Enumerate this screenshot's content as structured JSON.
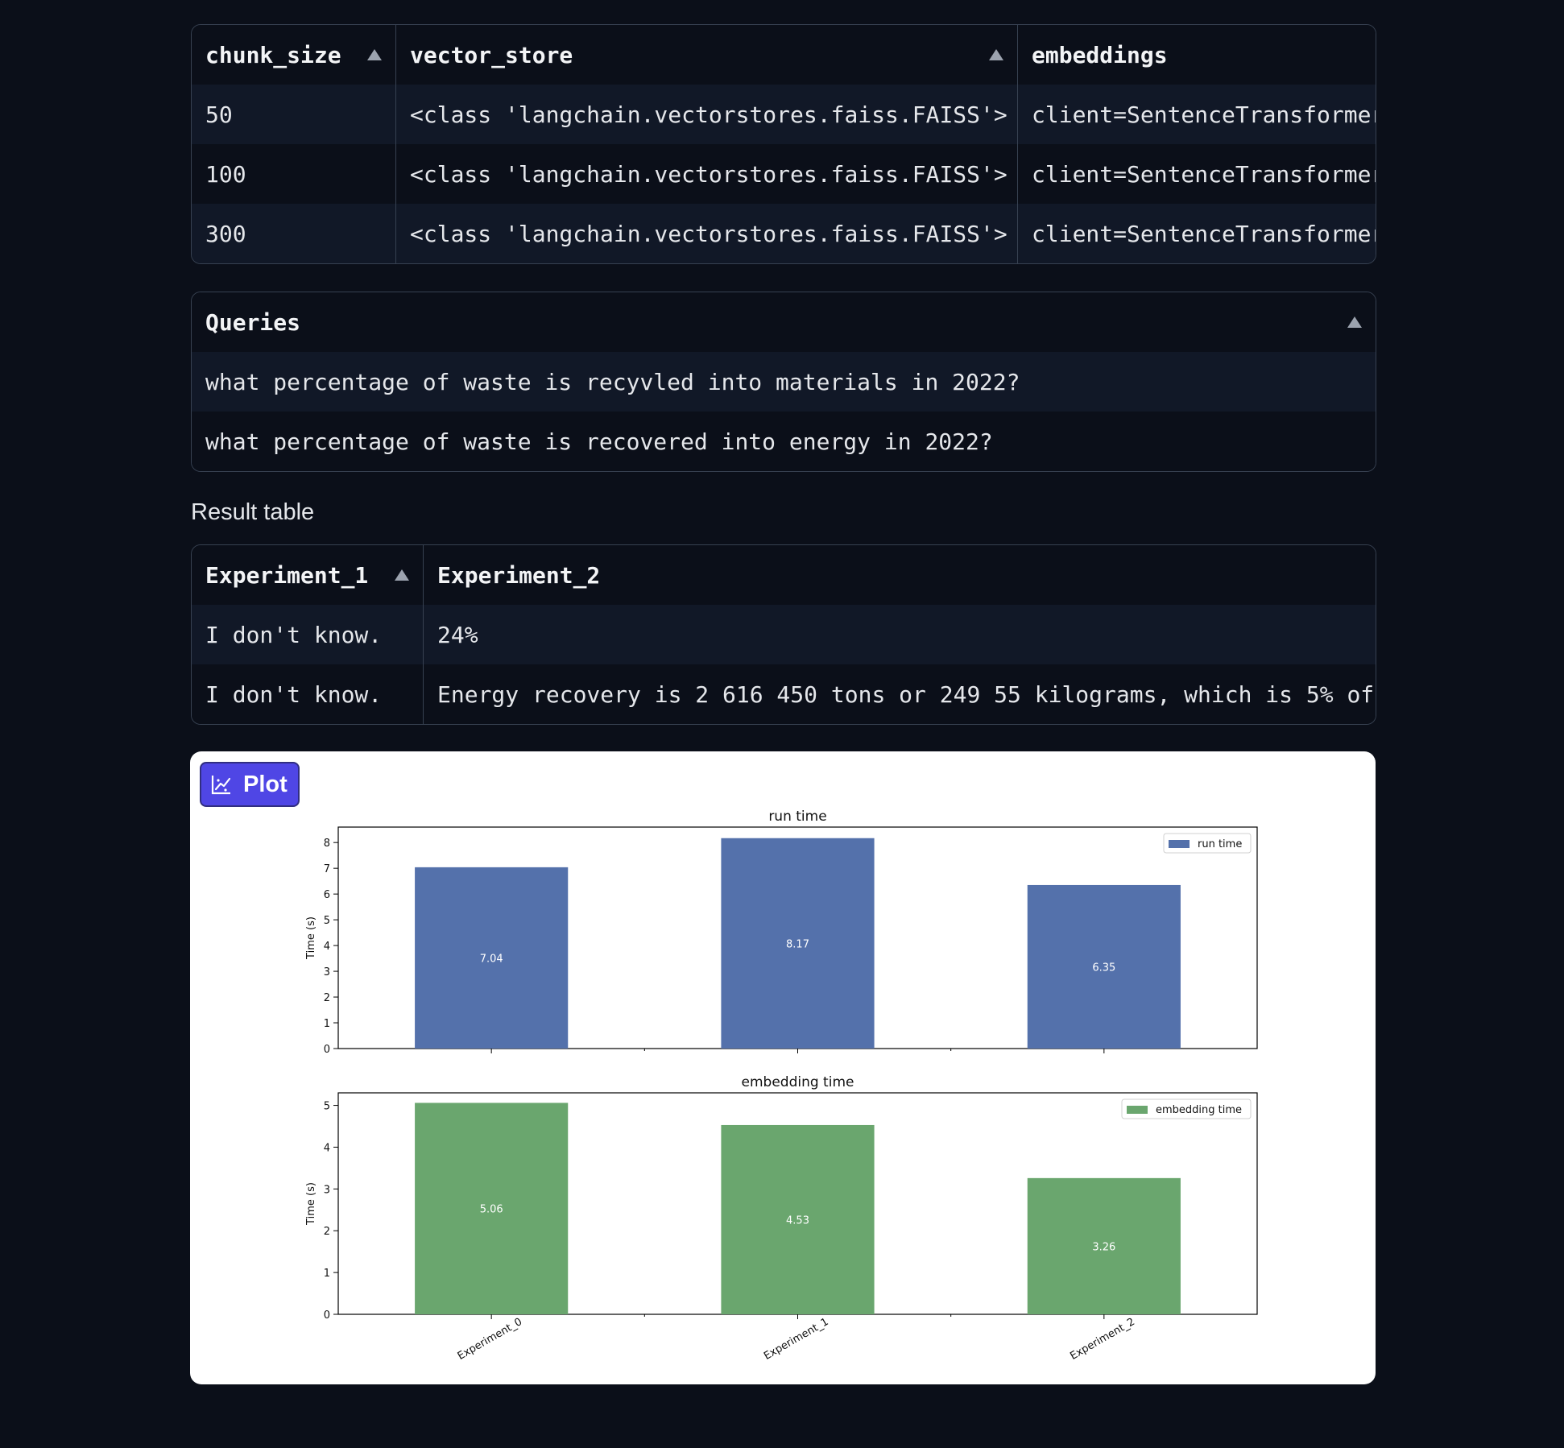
{
  "config_table": {
    "columns": [
      {
        "label": "chunk_size",
        "sortable": true
      },
      {
        "label": "vector_store",
        "sortable": true
      },
      {
        "label": "embeddings",
        "sortable": false
      }
    ],
    "rows": [
      [
        "50",
        "<class 'langchain.vectorstores.faiss.FAISS'>",
        "client=SentenceTransformer"
      ],
      [
        "100",
        "<class 'langchain.vectorstores.faiss.FAISS'>",
        "client=SentenceTransformer"
      ],
      [
        "300",
        "<class 'langchain.vectorstores.faiss.FAISS'>",
        "client=SentenceTransformer"
      ]
    ]
  },
  "queries_table": {
    "header": "Queries",
    "rows": [
      "what percentage of waste is recyvled into materials in 2022?",
      "what percentage of waste is recovered into energy in 2022?"
    ]
  },
  "result_label": "Result table",
  "result_table": {
    "columns": [
      {
        "label": "Experiment_1",
        "sortable": true
      },
      {
        "label": "Experiment_2",
        "sortable": false
      }
    ],
    "rows": [
      [
        "I don't know.",
        "24%"
      ],
      [
        "I don't know.",
        "Energy recovery is 2 616 450 tons or 249 55 kilograms, which is 5% of"
      ]
    ]
  },
  "plot": {
    "badge_label": "Plot",
    "badge_icon": "chart-icon"
  },
  "chart_data": [
    {
      "type": "bar",
      "title": "run time",
      "ylabel": "Time (s)",
      "categories": [
        "Experiment_0",
        "Experiment_1",
        "Experiment_2"
      ],
      "series": [
        {
          "name": "run time",
          "values": [
            7.04,
            8.17,
            6.35
          ],
          "labels": [
            "7.04",
            "8.17",
            "6.35"
          ]
        }
      ],
      "color": "#5471ab",
      "yticks": [
        "0",
        "1",
        "2",
        "3",
        "4",
        "5",
        "6",
        "7",
        "8"
      ],
      "ylim": [
        0,
        8.6
      ],
      "legend": "top-right",
      "show_xticklabels": false
    },
    {
      "type": "bar",
      "title": "embedding time",
      "ylabel": "Time (s)",
      "categories": [
        "Experiment_0",
        "Experiment_1",
        "Experiment_2"
      ],
      "series": [
        {
          "name": "embedding time",
          "values": [
            5.06,
            4.53,
            3.26
          ],
          "labels": [
            "5.06",
            "4.53",
            "3.26"
          ]
        }
      ],
      "color": "#6aa66e",
      "yticks": [
        "0",
        "1",
        "2",
        "3",
        "4",
        "5"
      ],
      "ylim": [
        0,
        5.3
      ],
      "legend": "top-right",
      "show_xticklabels": true
    }
  ]
}
